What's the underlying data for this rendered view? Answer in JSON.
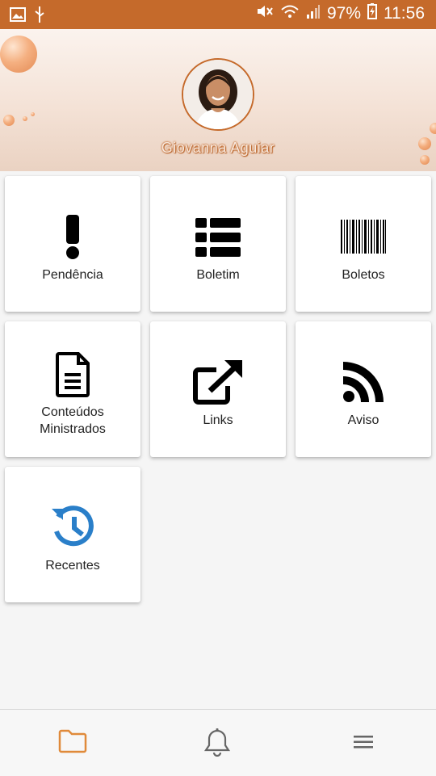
{
  "status_bar": {
    "battery": "97%",
    "time": "11:56",
    "icons": [
      "image-icon",
      "usb-icon",
      "mute-icon",
      "wifi-icon",
      "signal-icon",
      "battery-charging-icon"
    ]
  },
  "profile": {
    "name": "Giovanna Aguiar"
  },
  "tiles": [
    {
      "label": "Pendência",
      "icon": "exclamation-icon"
    },
    {
      "label": "Boletim",
      "icon": "table-list-icon"
    },
    {
      "label": "Boletos",
      "icon": "barcode-icon"
    },
    {
      "label_line1": "Conteúdos",
      "label_line2": "Ministrados",
      "icon": "file-text-icon"
    },
    {
      "label": "Links",
      "icon": "external-link-icon"
    },
    {
      "label": "Aviso",
      "icon": "rss-icon"
    },
    {
      "label": "Recentes",
      "icon": "history-icon"
    }
  ],
  "bottom_nav": {
    "items": [
      "folder-icon",
      "bell-icon",
      "menu-icon"
    ],
    "active": "folder-icon"
  },
  "colors": {
    "accent": "#c56a2b",
    "active_nav": "#e08a3a",
    "recentes_icon": "#2a7fc9"
  }
}
